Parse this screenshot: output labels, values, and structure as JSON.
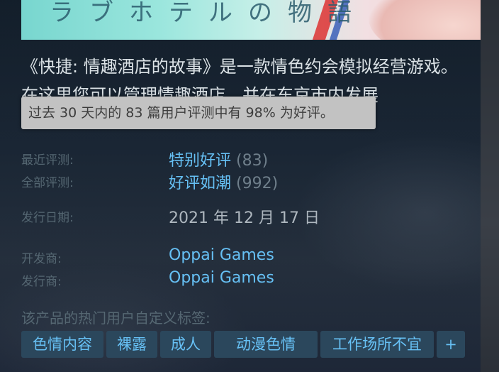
{
  "capsule": {
    "art_text": "ラブホテルの物語"
  },
  "description": "《快捷: 情趣酒店的故事》是一款情色约会模拟经营游戏。在这里您可以管理情趣酒店，并在东京市内发展",
  "tooltip": "过去 30 天内的 83 篇用户评测中有 98% 为好评。",
  "reviews": {
    "recent": {
      "label": "最近评测:",
      "summary": "特别好评",
      "count": "(83)"
    },
    "all": {
      "label": "全部评测:",
      "summary": "好评如潮",
      "count": "(992)"
    }
  },
  "release": {
    "label": "发行日期:",
    "value": "2021 年 12 月 17 日"
  },
  "developer": {
    "label": "开发商:",
    "value": "Oppai Games"
  },
  "publisher": {
    "label": "发行商:",
    "value": "Oppai Games"
  },
  "tags": {
    "title": "该产品的热门用户自定义标签:",
    "items": [
      "色情内容",
      "裸露",
      "成人",
      "动漫色情",
      "工作场所不宜",
      "+"
    ]
  }
}
